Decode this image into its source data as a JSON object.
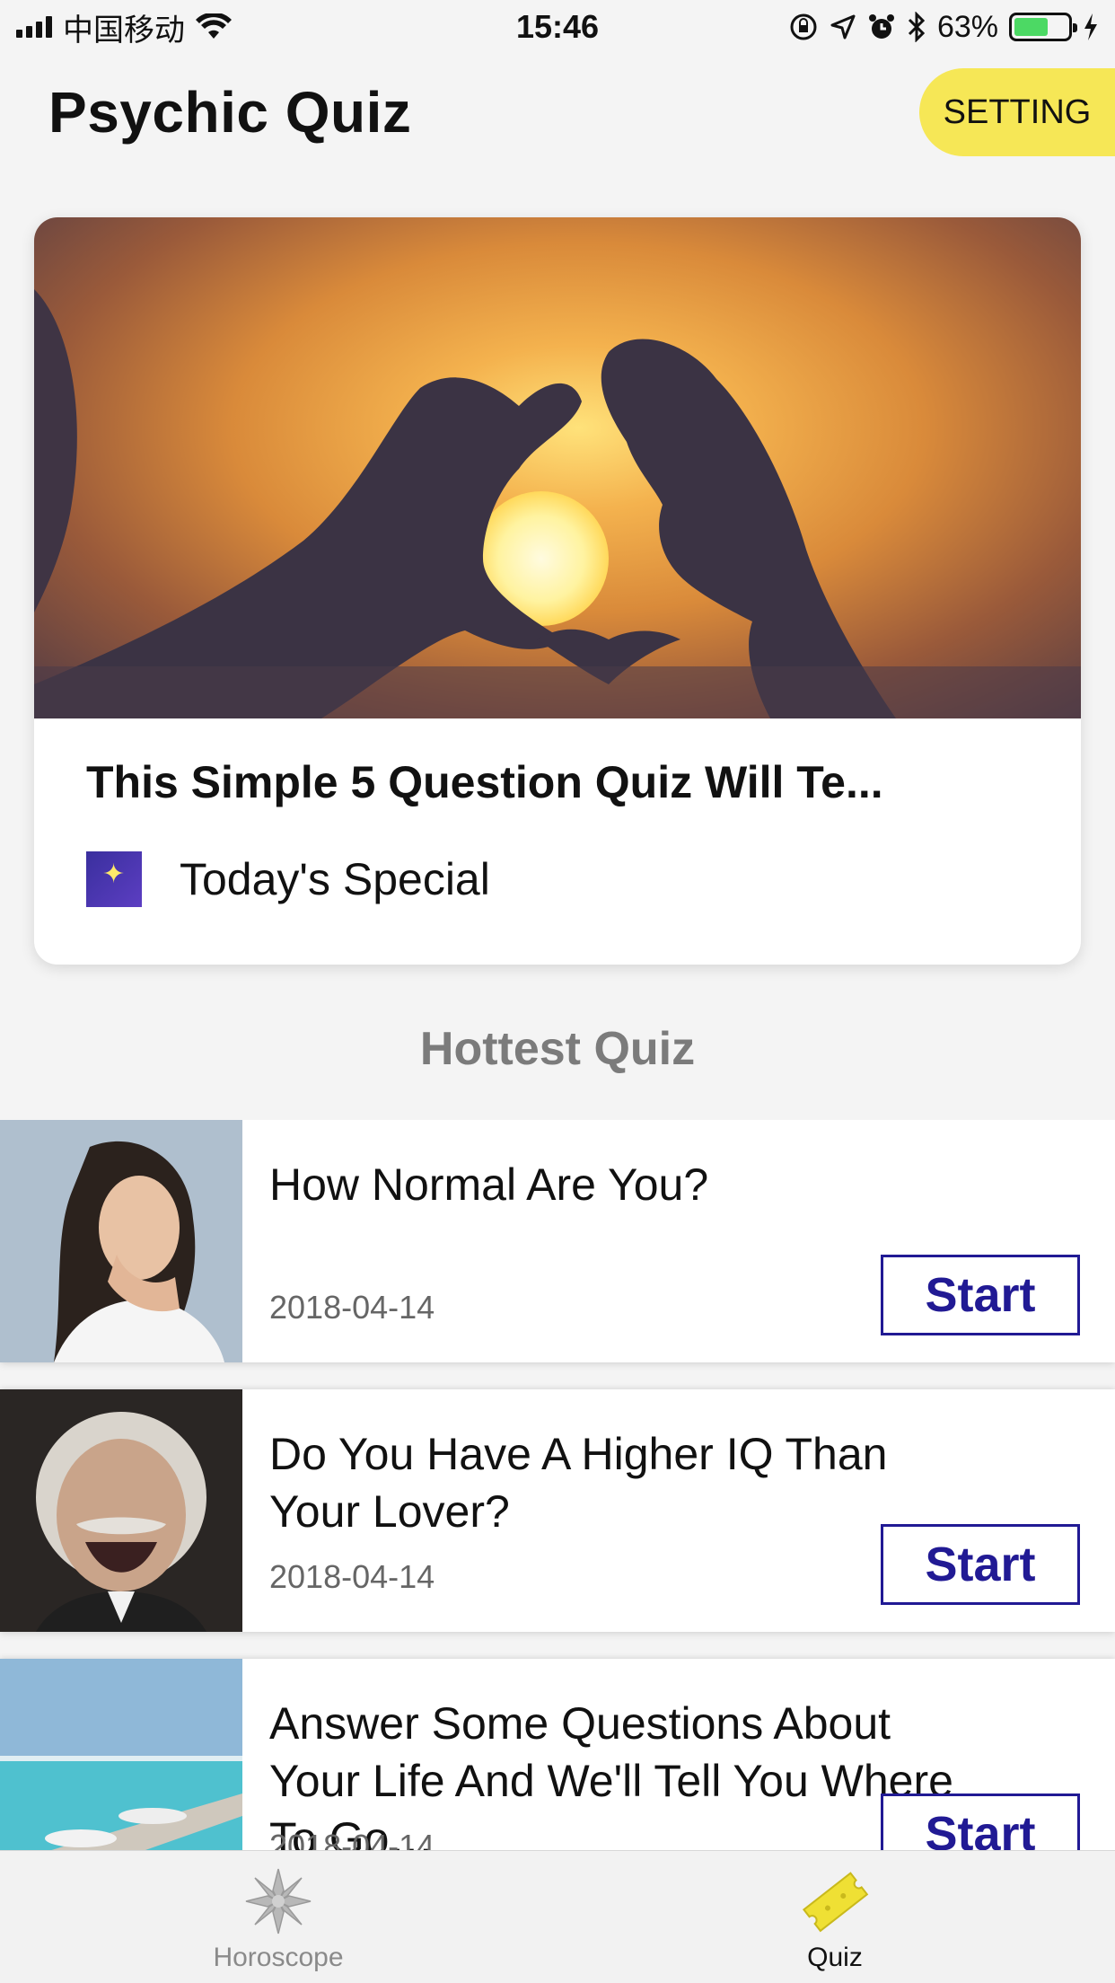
{
  "status_bar": {
    "carrier": "中国移动",
    "time": "15:46",
    "battery_percent": "63%",
    "battery_level": 0.63
  },
  "header": {
    "title": "Psychic Quiz",
    "setting_label": "SETTING"
  },
  "featured": {
    "title": "This Simple 5 Question Quiz Will Te...",
    "subtitle": "Today's Special"
  },
  "section": {
    "title": "Hottest Quiz"
  },
  "quizzes": [
    {
      "title": "How Normal Are You?",
      "date": "2018-04-14",
      "start_label": "Start"
    },
    {
      "title": "Do You Have A Higher IQ Than Your Lover?",
      "date": "2018-04-14",
      "start_label": "Start"
    },
    {
      "title": "Answer Some Questions About Your Life And We'll Tell You Where To Go…",
      "date": "2018-04-14",
      "start_label": "Start"
    }
  ],
  "tabs": [
    {
      "label": "Horoscope",
      "active": false
    },
    {
      "label": "Quiz",
      "active": true
    }
  ],
  "colors": {
    "accent_yellow": "#f6e756",
    "start_button": "#211a94",
    "section_title": "#7b7b7b"
  }
}
